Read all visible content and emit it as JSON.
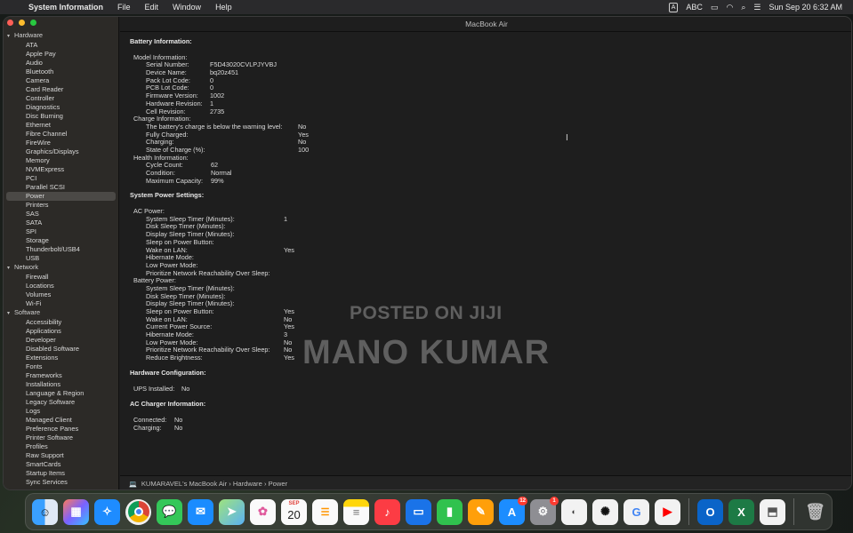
{
  "menubar": {
    "app_name": "System Information",
    "menus": [
      "File",
      "Edit",
      "Window",
      "Help"
    ],
    "input_source": "ABC",
    "input_badge": "A",
    "datetime": "Sun Sep 20  6:32 AM"
  },
  "window": {
    "title": "MacBook Air"
  },
  "sidebar": {
    "hardware_label": "Hardware",
    "hardware_items": [
      "ATA",
      "Apple Pay",
      "Audio",
      "Bluetooth",
      "Camera",
      "Card Reader",
      "Controller",
      "Diagnostics",
      "Disc Burning",
      "Ethernet",
      "Fibre Channel",
      "FireWire",
      "Graphics/Displays",
      "Memory",
      "NVMExpress",
      "PCI",
      "Parallel SCSI",
      "Power",
      "Printers",
      "SAS",
      "SATA",
      "SPI",
      "Storage",
      "Thunderbolt/USB4",
      "USB"
    ],
    "selected_item": "Power",
    "network_label": "Network",
    "network_items": [
      "Firewall",
      "Locations",
      "Volumes",
      "Wi-Fi"
    ],
    "software_label": "Software",
    "software_items": [
      "Accessibility",
      "Applications",
      "Developer",
      "Disabled Software",
      "Extensions",
      "Fonts",
      "Frameworks",
      "Installations",
      "Language & Region",
      "Legacy Software",
      "Logs",
      "Managed Client",
      "Preference Panes",
      "Printer Software",
      "Profiles",
      "Raw Support",
      "SmartCards",
      "Startup Items",
      "Sync Services"
    ]
  },
  "battery": {
    "heading": "Battery Information:",
    "model_label": "Model Information:",
    "serial_k": "Serial Number:",
    "serial_v": "F5D43020CVLPJYVBJ",
    "device_k": "Device Name:",
    "device_v": "bq20z451",
    "pack_k": "Pack Lot Code:",
    "pack_v": "0",
    "pcb_k": "PCB Lot Code:",
    "pcb_v": "0",
    "fw_k": "Firmware Version:",
    "fw_v": "1002",
    "hw_k": "Hardware Revision:",
    "hw_v": "1",
    "cell_k": "Cell Revision:",
    "cell_v": "2735",
    "charge_label": "Charge Information:",
    "warn_k": "The battery's charge is below the warning level:",
    "warn_v": "No",
    "full_k": "Fully Charged:",
    "full_v": "Yes",
    "charging_k": "Charging:",
    "charging_v": "No",
    "soc_k": "State of Charge (%):",
    "soc_v": "100",
    "health_label": "Health Information:",
    "cycle_k": "Cycle Count:",
    "cycle_v": "62",
    "cond_k": "Condition:",
    "cond_v": "Normal",
    "max_k": "Maximum Capacity:",
    "max_v": "99%"
  },
  "power_settings": {
    "heading": "System Power Settings:",
    "ac_label": "AC Power:",
    "ac_rows": [
      {
        "k": "System Sleep Timer (Minutes):",
        "v": "1"
      },
      {
        "k": "Disk Sleep Timer (Minutes):",
        "v": ""
      },
      {
        "k": "Display Sleep Timer (Minutes):",
        "v": ""
      },
      {
        "k": "Sleep on Power Button:",
        "v": ""
      },
      {
        "k": "Wake on LAN:",
        "v": "Yes"
      },
      {
        "k": "Hibernate Mode:",
        "v": ""
      },
      {
        "k": "Low Power Mode:",
        "v": ""
      },
      {
        "k": "Prioritize Network Reachability Over Sleep:",
        "v": ""
      }
    ],
    "battery_label": "Battery Power:",
    "battery_rows": [
      {
        "k": "System Sleep Timer (Minutes):",
        "v": ""
      },
      {
        "k": "Disk Sleep Timer (Minutes):",
        "v": ""
      },
      {
        "k": "Display Sleep Timer (Minutes):",
        "v": ""
      },
      {
        "k": "Sleep on Power Button:",
        "v": "Yes"
      },
      {
        "k": "Wake on LAN:",
        "v": "No"
      },
      {
        "k": "Current Power Source:",
        "v": "Yes"
      },
      {
        "k": "Hibernate Mode:",
        "v": "3"
      },
      {
        "k": "Low Power Mode:",
        "v": "No"
      },
      {
        "k": "Prioritize Network Reachability Over Sleep:",
        "v": "No"
      },
      {
        "k": "Reduce Brightness:",
        "v": "Yes"
      }
    ]
  },
  "hardware_config": {
    "heading": "Hardware Configuration:",
    "ups_k": "UPS Installed:",
    "ups_v": "No"
  },
  "ac_charger": {
    "heading": "AC Charger Information:",
    "connected_k": "Connected:",
    "connected_v": "No",
    "charging_k": "Charging:",
    "charging_v": "No"
  },
  "pathbar": {
    "items": [
      "KUMARAVEL's MacBook Air",
      "Hardware",
      "Power"
    ],
    "separator": "›"
  },
  "watermark": {
    "line1": "POSTED ON JIJI",
    "line2": "MANO KUMAR"
  },
  "dock": {
    "calendar_month": "SEP",
    "calendar_day": "20",
    "app_store_badge": "12",
    "settings_badge": "1",
    "icons": [
      "finder-icon",
      "launchpad-icon",
      "safari-icon",
      "chrome-icon",
      "messages-icon",
      "mail-icon",
      "maps-icon",
      "photos-icon",
      "calendar-icon",
      "reminders-icon",
      "notes-icon",
      "music-icon",
      "keynote-icon",
      "numbers-icon",
      "pages-icon",
      "app-store-icon",
      "system-settings-icon",
      "chatgpt-icon",
      "google-icon",
      "youtube-icon",
      "outlook-icon",
      "excel-icon",
      "preview-icon",
      "trash-icon"
    ]
  },
  "colors": {
    "accent_close": "#fe5f57",
    "accent_min": "#febc2e",
    "accent_max": "#28c840",
    "selection": "#4b4946"
  }
}
